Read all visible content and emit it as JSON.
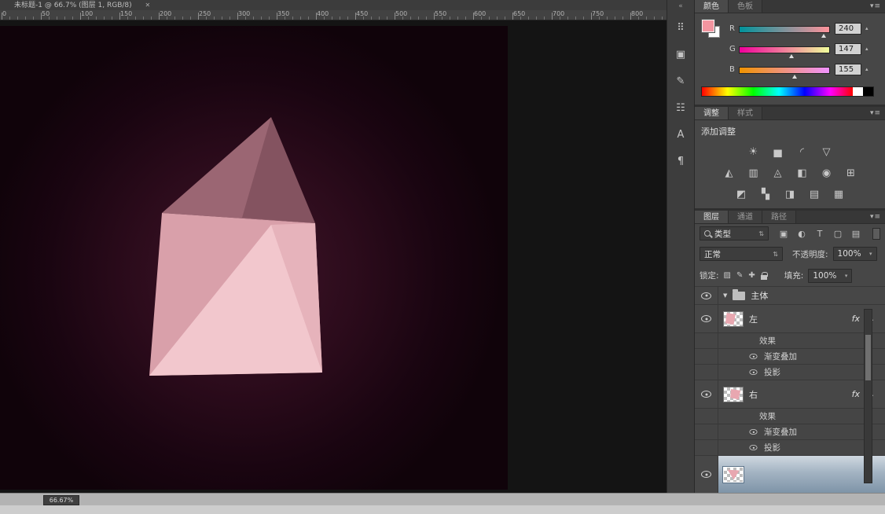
{
  "window": {
    "title": "未标题-1 @ 66.7% (图层 1, RGB/8)"
  },
  "ruler": {
    "labels": [
      "0",
      "50",
      "100",
      "150",
      "200",
      "250",
      "300",
      "350",
      "400",
      "450",
      "500",
      "550",
      "600",
      "650",
      "700",
      "750",
      "800"
    ]
  },
  "icons": {
    "panel_menu": "▾≡",
    "updown": "⇅",
    "dropdown": "▾",
    "stepper": "▴",
    "collapse": "▴",
    "expand": "▼",
    "close": "✕"
  },
  "colors": {
    "canvas_glow": "#401529",
    "canvas_edge": "#10030a",
    "prism_top": "#9b6673",
    "prism_front": "#d9a0aa",
    "prism_highlight": "#f2c7cd",
    "foreground_swatch": "#f295a0",
    "selected_layer": "#a3b3c2"
  },
  "dock": {
    "icons": [
      {
        "name": "collapse-dock-icon",
        "glyph": "«"
      },
      {
        "name": "brush-presets-panel-icon",
        "glyph": "⠿"
      },
      {
        "name": "clone-source-panel-icon",
        "glyph": "▣"
      },
      {
        "name": "tool-presets-panel-icon",
        "glyph": "✎"
      },
      {
        "name": "histogram-panel-icon",
        "glyph": "☷"
      },
      {
        "name": "character-panel-icon",
        "glyph": "A"
      },
      {
        "name": "paragraph-panel-icon",
        "glyph": "¶"
      }
    ]
  },
  "color_panel": {
    "tabs": [
      {
        "label": "颜色",
        "active": true
      },
      {
        "label": "色板",
        "active": false
      }
    ],
    "channels": [
      {
        "label": "R",
        "value": "240",
        "pos": 94
      },
      {
        "label": "G",
        "value": "147",
        "pos": 58
      },
      {
        "label": "B",
        "value": "155",
        "pos": 61
      }
    ]
  },
  "adjust_panel": {
    "tabs": [
      {
        "label": "调整",
        "active": true
      },
      {
        "label": "样式",
        "active": false
      }
    ],
    "add_label": "添加调整",
    "rows": [
      [
        {
          "name": "brightness-contrast-icon",
          "glyph": "☀"
        },
        {
          "name": "levels-icon",
          "glyph": "▅"
        },
        {
          "name": "curves-icon",
          "glyph": "◜"
        },
        {
          "name": "exposure-icon",
          "glyph": "▽"
        }
      ],
      [
        {
          "name": "vibrance-icon",
          "glyph": "◭"
        },
        {
          "name": "hue-saturation-icon",
          "glyph": "▥"
        },
        {
          "name": "color-balance-icon",
          "glyph": "◬"
        },
        {
          "name": "black-white-icon",
          "glyph": "◧"
        },
        {
          "name": "photo-filter-icon",
          "glyph": "◉"
        },
        {
          "name": "channel-mixer-icon",
          "glyph": "⊞"
        }
      ],
      [
        {
          "name": "invert-icon",
          "glyph": "◩"
        },
        {
          "name": "posterize-icon",
          "glyph": "▚"
        },
        {
          "name": "threshold-icon",
          "glyph": "◨"
        },
        {
          "name": "gradient-map-icon",
          "glyph": "▤"
        },
        {
          "name": "selective-color-icon",
          "glyph": "▦"
        }
      ]
    ]
  },
  "layers_panel": {
    "tabs": [
      {
        "label": "图层",
        "active": true
      },
      {
        "label": "通道",
        "active": false
      },
      {
        "label": "路径",
        "active": false
      }
    ],
    "filter_label": "类型",
    "filter_icons": [
      {
        "name": "filter-pixel-layers-icon",
        "glyph": "▣"
      },
      {
        "name": "filter-adjustment-layers-icon",
        "glyph": "◐"
      },
      {
        "name": "filter-type-layers-icon",
        "glyph": "T"
      },
      {
        "name": "filter-shape-layers-icon",
        "glyph": "▢"
      },
      {
        "name": "filter-smart-objects-icon",
        "glyph": "▤"
      }
    ],
    "blend_mode": "正常",
    "opacity_label": "不透明度:",
    "opacity_value": "100%",
    "lock_label": "锁定:",
    "lock_icons": [
      {
        "name": "lock-transparent-icon",
        "glyph": "▨"
      },
      {
        "name": "lock-paint-icon",
        "glyph": "✎"
      },
      {
        "name": "lock-move-icon",
        "glyph": "✚"
      },
      {
        "name": "lock-all-icon",
        "glyph": ""
      }
    ],
    "fill_label": "填充:",
    "fill_value": "100%",
    "group_name": "主体",
    "fx_label": "fx",
    "effects_header": "效果",
    "layers": [
      {
        "name": "左",
        "effects": [
          "渐变叠加",
          "投影"
        ]
      },
      {
        "name": "右",
        "effects": [
          "渐变叠加",
          "投影"
        ]
      }
    ]
  },
  "statusbar": {
    "zoom": "66.67%"
  }
}
